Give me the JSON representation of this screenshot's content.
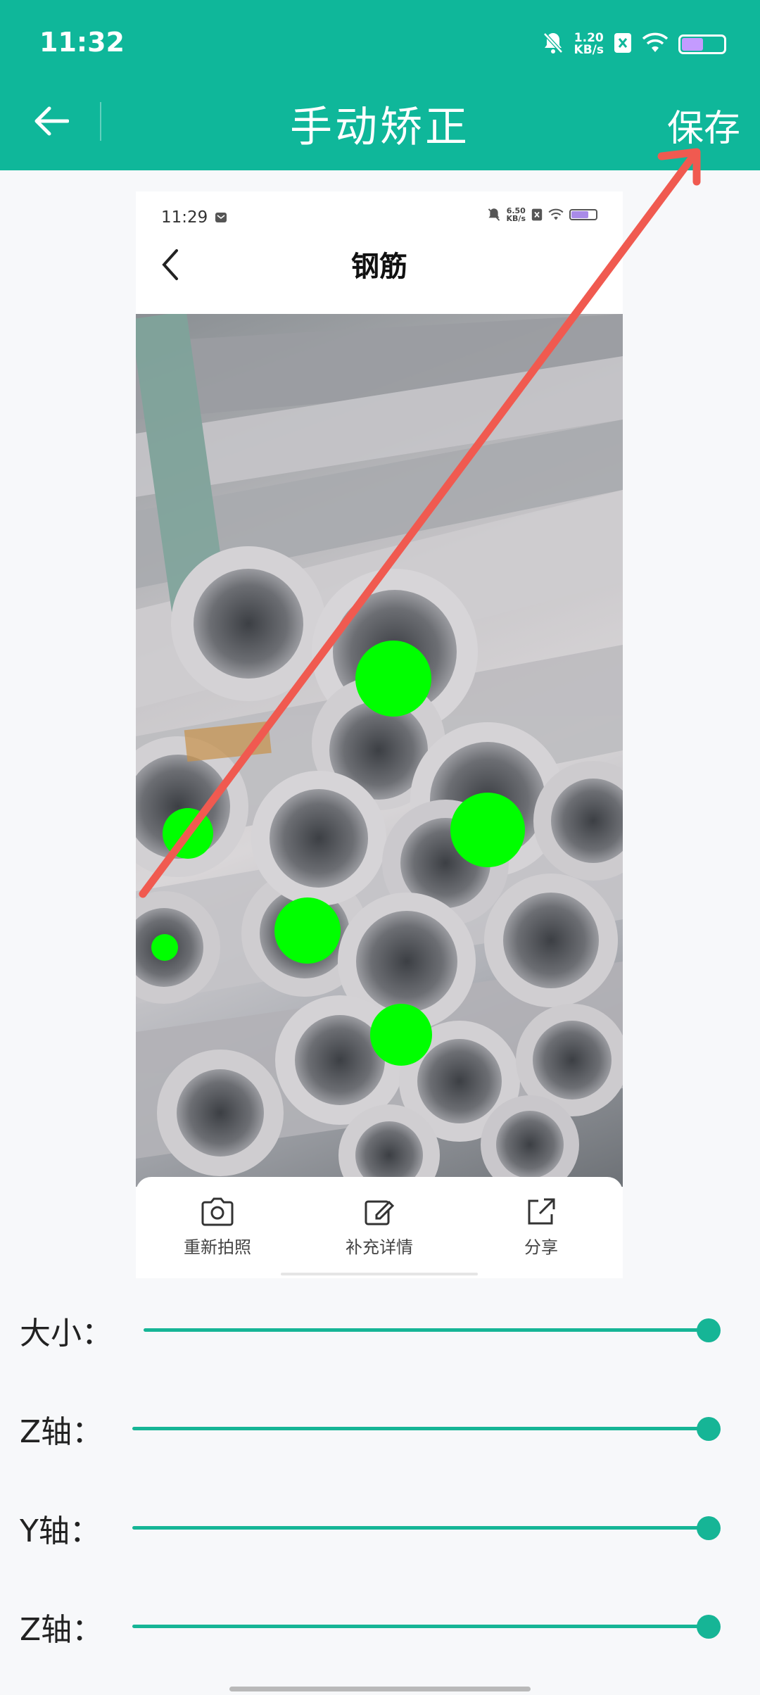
{
  "status_bar": {
    "time": "11:32",
    "net_speed_value": "1.20",
    "net_speed_unit": "KB/s",
    "icons": [
      "bell-muted-icon",
      "sim-x-icon",
      "wifi-icon",
      "battery-icon"
    ]
  },
  "header": {
    "title": "手动矫正",
    "save_label": "保存",
    "back_icon": "arrow-left-icon"
  },
  "inner_screen": {
    "status_time": "11:29",
    "net_speed_value": "6.50",
    "net_speed_unit": "KB/s",
    "title": "钢筋",
    "toolbar": [
      {
        "label": "重新拍照",
        "icon": "camera-icon"
      },
      {
        "label": "补充详情",
        "icon": "edit-icon"
      },
      {
        "label": "分享",
        "icon": "share-icon"
      }
    ],
    "marker_color": "#00ff00"
  },
  "sliders": [
    {
      "label": "大小：",
      "value": 1.0
    },
    {
      "label": "Z轴：",
      "value": 1.0
    },
    {
      "label": "Y轴：",
      "value": 1.0
    },
    {
      "label": "Z轴：",
      "value": 1.0
    }
  ],
  "colors": {
    "accent": "#0fb79a",
    "slider": "#16b596",
    "annotation_arrow": "#f05a50"
  }
}
